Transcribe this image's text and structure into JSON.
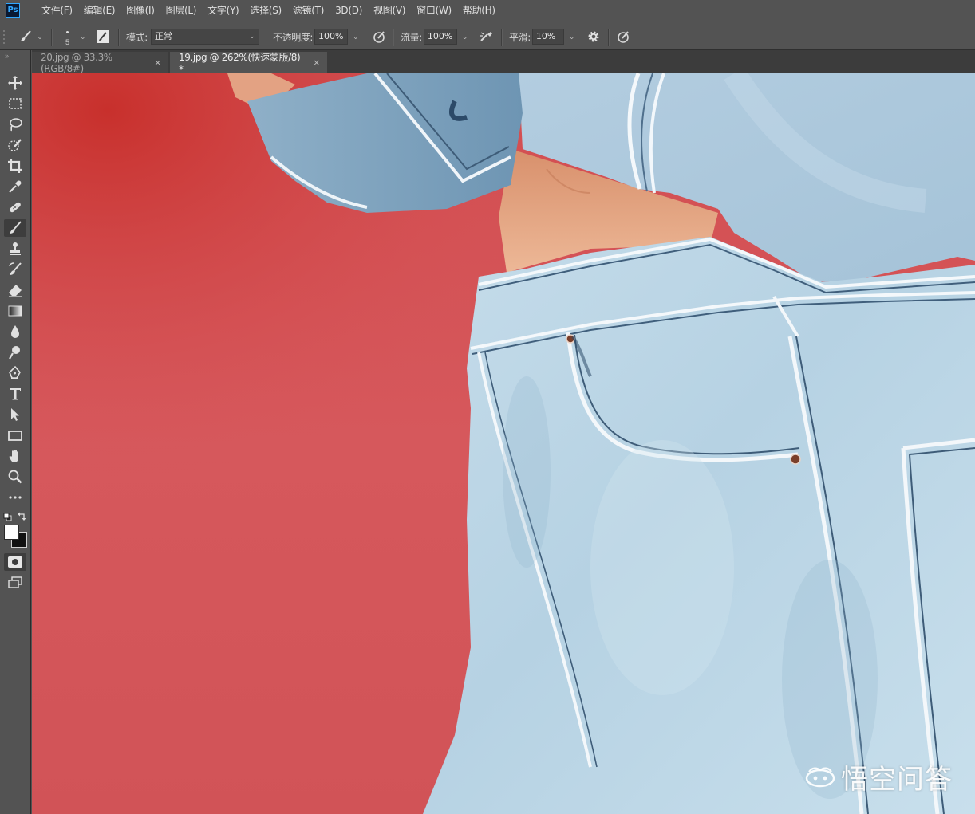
{
  "app": {
    "logo": "Ps"
  },
  "menu": [
    "文件(F)",
    "编辑(E)",
    "图像(I)",
    "图层(L)",
    "文字(Y)",
    "选择(S)",
    "滤镜(T)",
    "3D(D)",
    "视图(V)",
    "窗口(W)",
    "帮助(H)"
  ],
  "options": {
    "brush_size": "5",
    "mode_label": "模式:",
    "mode_value": "正常",
    "opacity_label": "不透明度:",
    "opacity_value": "100%",
    "flow_label": "流量:",
    "flow_value": "100%",
    "smoothing_label": "平滑:",
    "smoothing_value": "10%"
  },
  "tabs": [
    {
      "label": "20.jpg @ 33.3%(RGB/8#)",
      "close": "×",
      "active": false
    },
    {
      "label": "19.jpg @ 262%(快速蒙版/8) *",
      "close": "×",
      "active": true
    }
  ],
  "tools": [
    "move-icon",
    "marquee-icon",
    "lasso-icon",
    "quick-selection-icon",
    "crop-icon",
    "eyedropper-icon",
    "healing-brush-icon",
    "brush-icon",
    "clone-stamp-icon",
    "history-brush-icon",
    "eraser-icon",
    "gradient-icon",
    "blur-icon",
    "dodge-icon",
    "pen-icon",
    "type-icon",
    "path-selection-icon",
    "rectangle-icon",
    "hand-icon",
    "zoom-icon",
    "more-tools-icon"
  ],
  "colors": {
    "ui_bg": "#535353",
    "tab_bar": "#3c3c3c",
    "canvas_background_red": "#d3565a",
    "denim_light": "#b9d4e4",
    "denim_dark": "#7ea8c4",
    "skin": "#e6a686"
  },
  "watermark": "悟空问答"
}
